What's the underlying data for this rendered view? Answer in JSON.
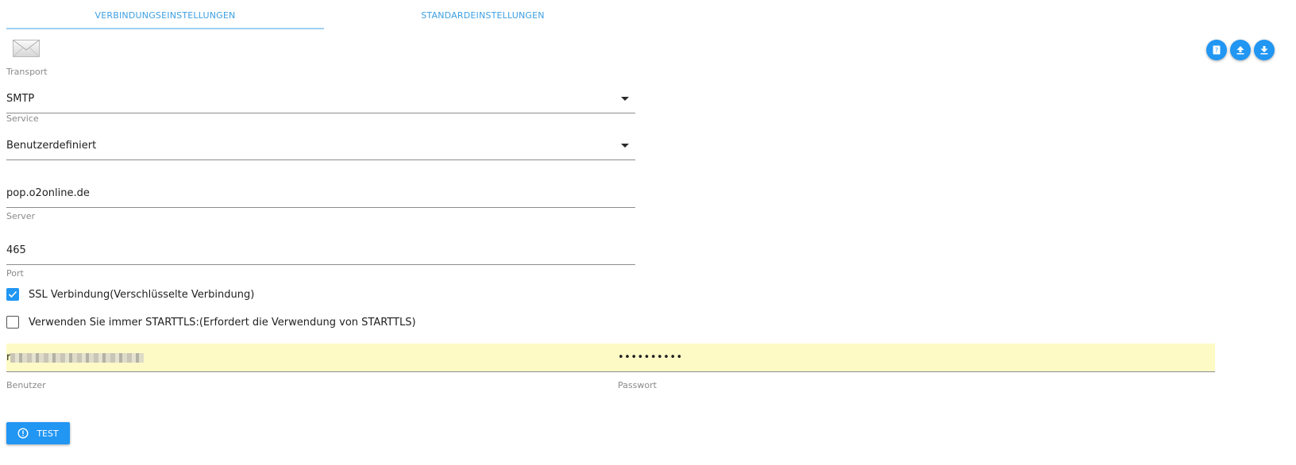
{
  "tabs": [
    {
      "label": "VERBINDUNGSEINSTELLUNGEN",
      "active": true
    },
    {
      "label": "STANDARDEINSTELLUNGEN",
      "active": false
    }
  ],
  "icons": {
    "mail": "mail-icon",
    "help": "help-icon",
    "upload": "upload-icon",
    "download": "download-icon",
    "test": "alert-circle-icon"
  },
  "colors": {
    "accent": "#2196f3",
    "tab_text": "#3c9fe2",
    "autofill": "#fefac6"
  },
  "form": {
    "transport": {
      "label": "Transport",
      "value": "SMTP"
    },
    "service": {
      "label": "Service",
      "value": "Benutzerdefiniert"
    },
    "server": {
      "label": "Server",
      "value": "pop.o2online.de"
    },
    "port": {
      "label": "Port",
      "value": "465"
    },
    "ssl": {
      "label": "SSL Verbindung(Verschlüsselte Verbindung)",
      "checked": true
    },
    "starttls": {
      "label": "Verwenden Sie immer STARTTLS:(Erfordert die Verwendung von STARTTLS)",
      "checked": false
    },
    "user": {
      "label": "Benutzer",
      "prefix": "r"
    },
    "password": {
      "label": "Passwort",
      "value": "••••••••••"
    }
  },
  "buttons": {
    "test_label": "TEST"
  }
}
